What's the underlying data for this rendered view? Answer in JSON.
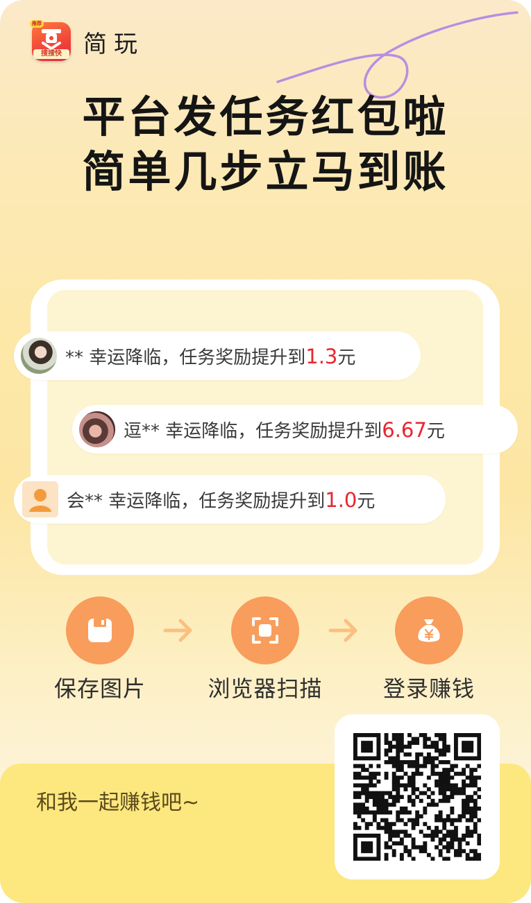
{
  "brand": {
    "logo_tag": "搜搜快",
    "logo_corner": "推荐",
    "name": "简玩"
  },
  "headline": {
    "line1": "平台发任务红包啦",
    "line2": "简单几步立马到账"
  },
  "notices": [
    {
      "prefix": "** 幸运降临，任务奖励提升到",
      "amount": "1.3",
      "unit": "元"
    },
    {
      "prefix": "逗** 幸运降临，任务奖励提升到",
      "amount": "6.67",
      "unit": "元"
    },
    {
      "prefix": "会** 幸运降临，任务奖励提升到",
      "amount": "1.0",
      "unit": "元"
    }
  ],
  "steps": [
    {
      "label": "保存图片",
      "icon": "floppy-disk-icon"
    },
    {
      "label": "浏览器扫描",
      "icon": "scan-frame-icon"
    },
    {
      "label": "登录赚钱",
      "icon": "money-bag-yen-icon"
    }
  ],
  "footer": {
    "text": "和我一起赚钱吧~"
  },
  "colors": {
    "accent_orange": "#f89d5c",
    "amount_red": "#e8262f",
    "footer_yellow": "#fde77f"
  }
}
